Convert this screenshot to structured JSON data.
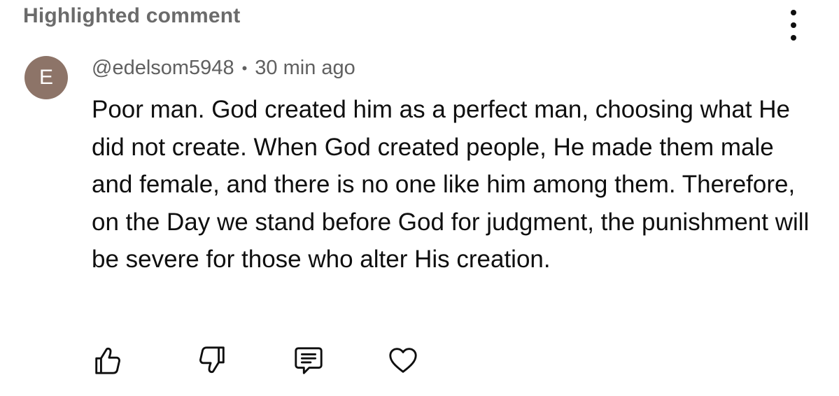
{
  "header": {
    "title": "Highlighted comment",
    "more_icon": "more-vert-icon"
  },
  "comment": {
    "avatar_letter": "E",
    "avatar_color": "#8d7468",
    "author": "@edelsom5948",
    "separator": "•",
    "time": "30 min ago",
    "text": "Poor man. God created him as a perfect man, choosing what He did not create. When God created people, He made them male and female, and there is no one like him among them. Therefore, on the Day we stand before God for judgment, the punishment will be severe for those who alter His creation."
  },
  "actions": [
    {
      "name": "like",
      "icon": "thumbs-up-icon"
    },
    {
      "name": "dislike",
      "icon": "thumbs-down-icon"
    },
    {
      "name": "reply",
      "icon": "comment-icon"
    },
    {
      "name": "heart",
      "icon": "heart-icon"
    }
  ]
}
